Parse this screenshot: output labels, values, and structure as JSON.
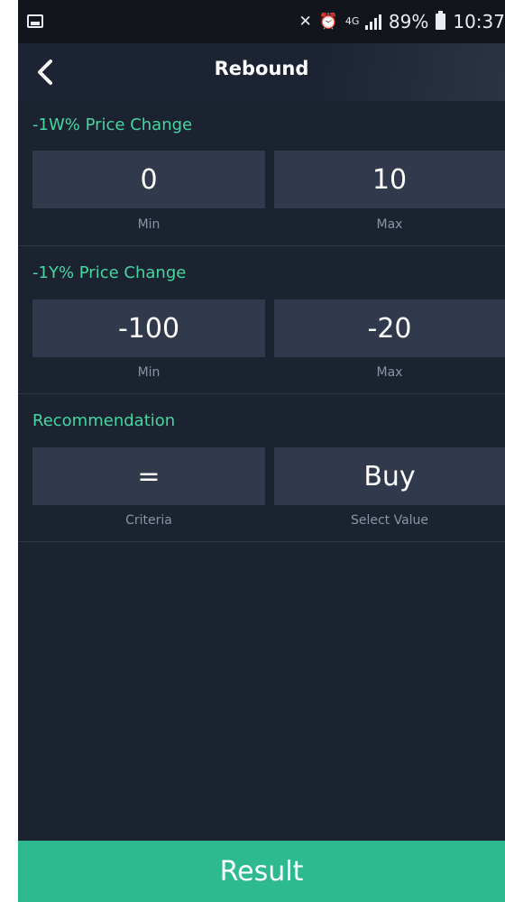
{
  "status_bar": {
    "network": "4G",
    "battery": "89%",
    "time": "10:37"
  },
  "header": {
    "title": "Rebound",
    "back_icon": "chevron-left-icon"
  },
  "filters": [
    {
      "title": "-1W% Price Change",
      "left_value": "0",
      "left_caption": "Min",
      "right_value": "10",
      "right_caption": "Max"
    },
    {
      "title": "-1Y% Price Change",
      "left_value": "-100",
      "left_caption": "Min",
      "right_value": "-20",
      "right_caption": "Max"
    },
    {
      "title": "Recommendation",
      "left_value": "=",
      "left_caption": "Criteria",
      "right_value": "Buy",
      "right_caption": "Select Value"
    }
  ],
  "result_button": {
    "label": "Result"
  },
  "colors": {
    "background": "#1b2331",
    "field": "#303a4c",
    "section_title": "#46d6a0",
    "result": "#2dba8e"
  }
}
